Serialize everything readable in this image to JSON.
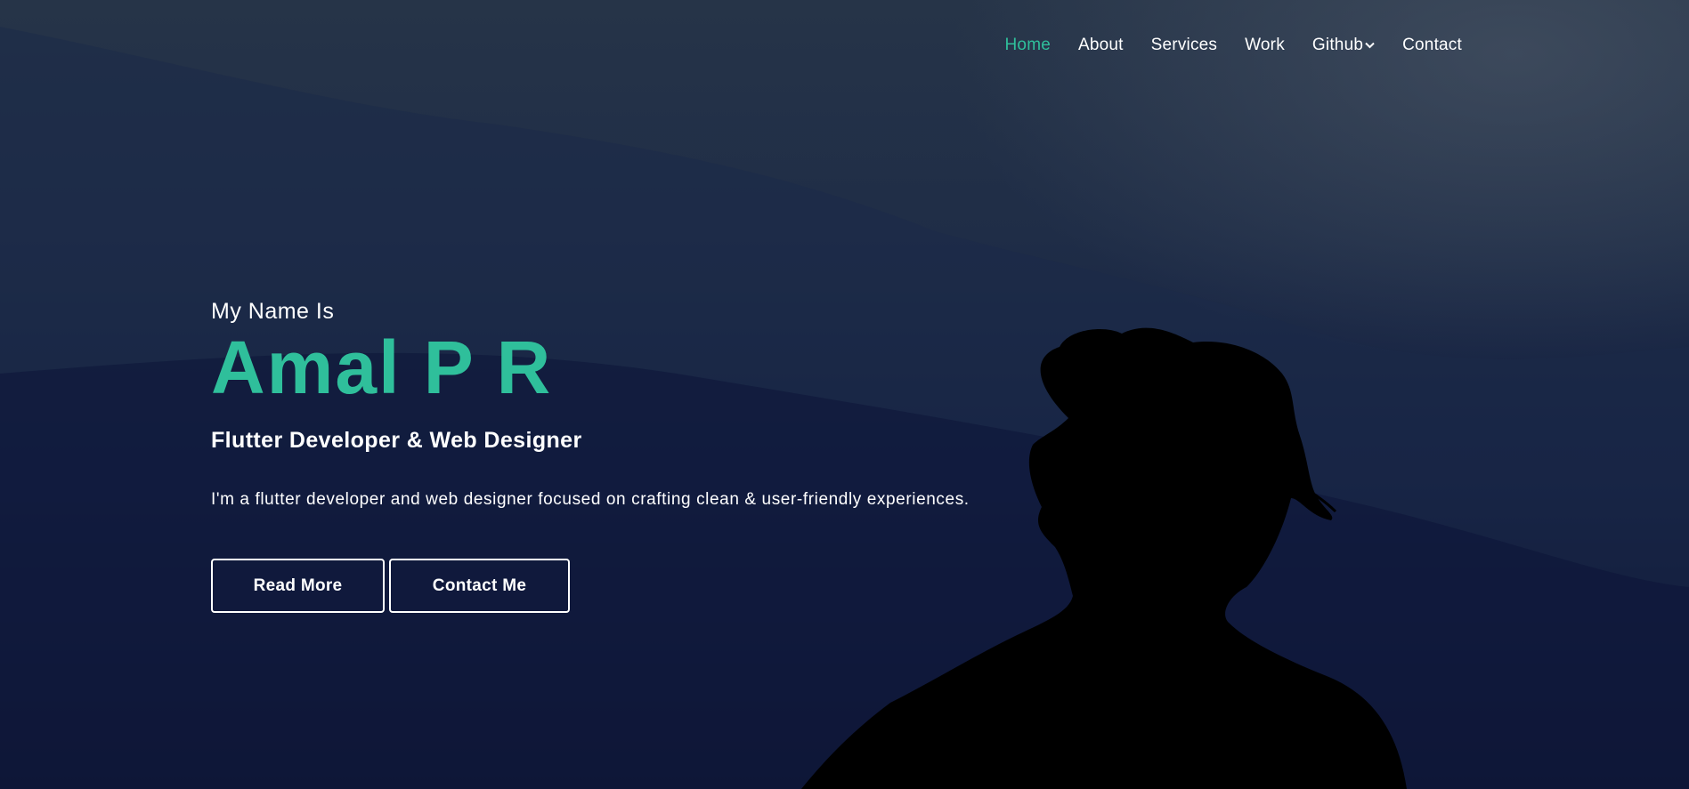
{
  "colors": {
    "accent": "#2fbf9b",
    "text": "#ffffff",
    "background_top": "#263448",
    "background_bottom": "#050822"
  },
  "nav": {
    "items": [
      {
        "label": "Home",
        "active": true
      },
      {
        "label": "About",
        "active": false
      },
      {
        "label": "Services",
        "active": false
      },
      {
        "label": "Work",
        "active": false
      },
      {
        "label": "Github",
        "active": false,
        "icon": "chevron-down-icon"
      },
      {
        "label": "Contact",
        "active": false
      }
    ]
  },
  "hero": {
    "intro": "My Name Is",
    "name": "Amal P R",
    "role": "Flutter Developer & Web Designer",
    "description": "I'm a flutter developer and web designer focused on crafting clean & user-friendly experiences.",
    "buttons": {
      "read_more": "Read More",
      "contact_me": "Contact Me"
    },
    "background_image": "person-silhouette-against-mountains"
  }
}
